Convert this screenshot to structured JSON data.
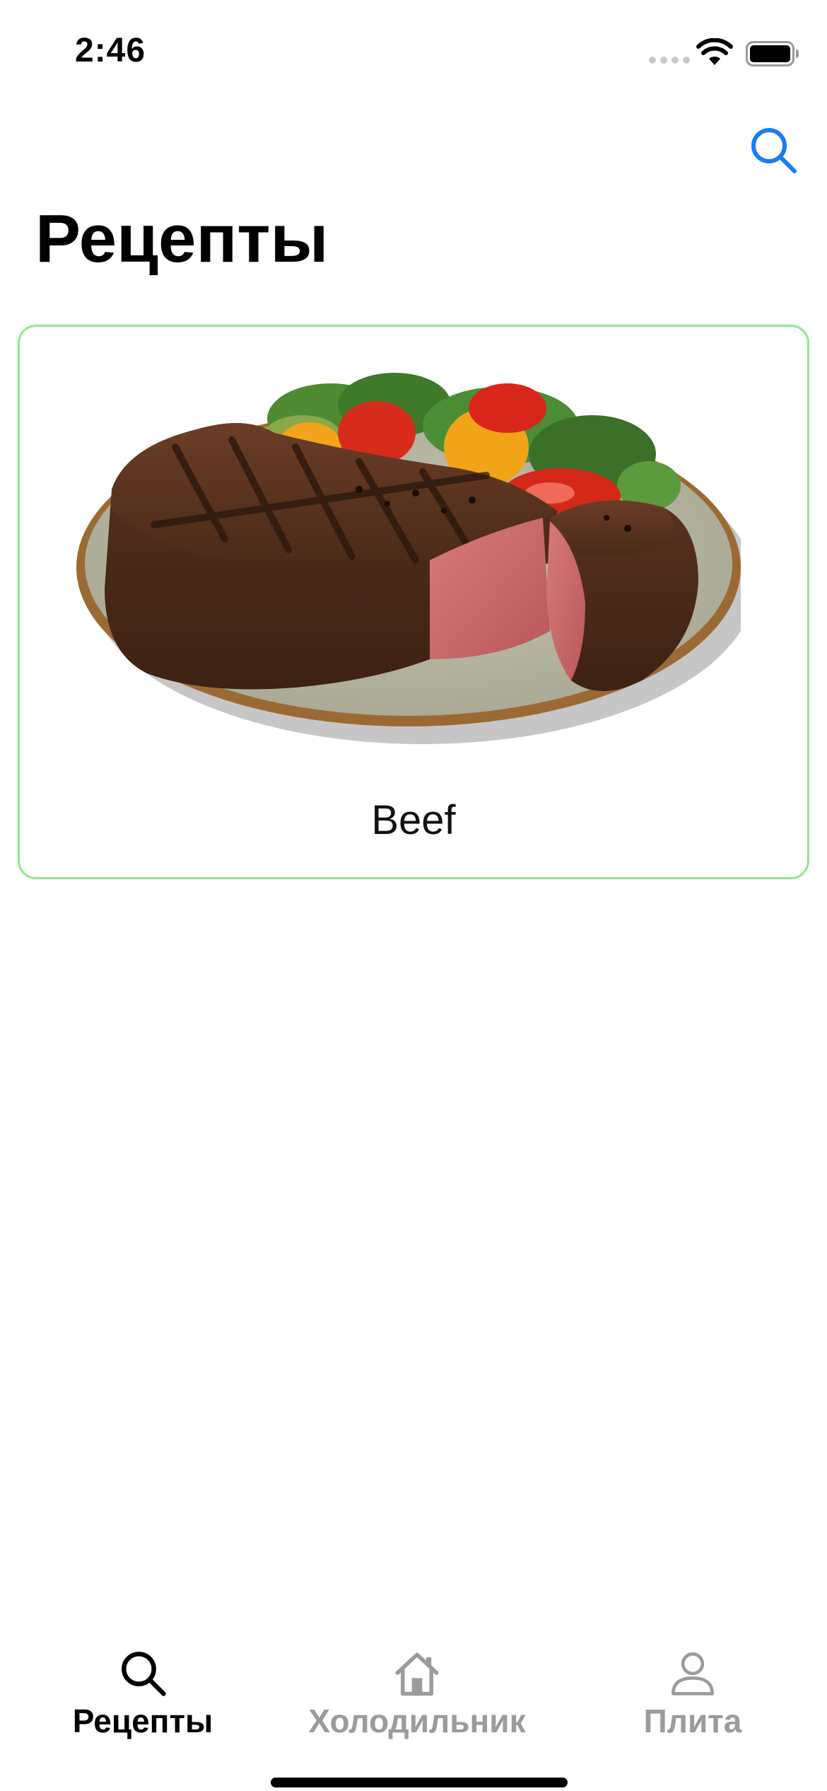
{
  "status_bar": {
    "time": "2:46",
    "icons": [
      "cellular-signal-icon",
      "wifi-icon",
      "battery-icon"
    ]
  },
  "nav": {
    "search_icon": "search-icon",
    "title": "Рецепты",
    "accent_color": "#1a7cf2"
  },
  "recipes": [
    {
      "name": "Beef",
      "image": "steak-plate-image",
      "border_color": "#8fe98c"
    }
  ],
  "tab_bar": {
    "tabs": [
      {
        "label": "Рецепты",
        "icon": "search-icon",
        "active": true
      },
      {
        "label": "Холодильник",
        "icon": "house-icon",
        "active": false
      },
      {
        "label": "Плита",
        "icon": "person-icon",
        "active": false
      }
    ],
    "active_color": "#000000",
    "inactive_color": "#9b9b9b"
  }
}
